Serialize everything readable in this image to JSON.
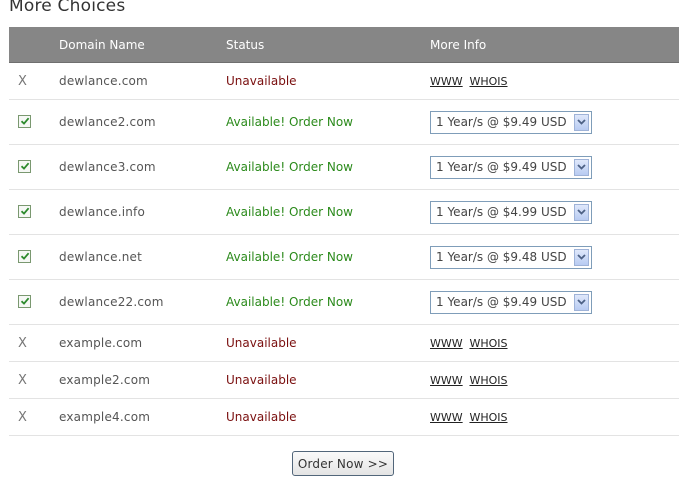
{
  "page_title": "More Choices",
  "table": {
    "headers": {
      "domain_name": "Domain Name",
      "status": "Status",
      "more_info": "More Info"
    },
    "rows": [
      {
        "domain": "dewlance.com",
        "available": false,
        "marker": "X",
        "status": "Unavailable",
        "www": "WWW",
        "whois": "WHOIS"
      },
      {
        "domain": "dewlance2.com",
        "available": true,
        "checked": true,
        "status": "Available! Order Now",
        "option": "1 Year/s @ $9.49 USD"
      },
      {
        "domain": "dewlance3.com",
        "available": true,
        "checked": true,
        "status": "Available! Order Now",
        "option": "1 Year/s @ $9.49 USD"
      },
      {
        "domain": "dewlance.info",
        "available": true,
        "checked": true,
        "status": "Available! Order Now",
        "option": "1 Year/s @ $4.99 USD"
      },
      {
        "domain": "dewlance.net",
        "available": true,
        "checked": true,
        "status": "Available! Order Now",
        "option": "1 Year/s @ $9.48 USD"
      },
      {
        "domain": "dewlance22.com",
        "available": true,
        "checked": true,
        "status": "Available! Order Now",
        "option": "1 Year/s @ $9.49 USD"
      },
      {
        "domain": "example.com",
        "available": false,
        "marker": "X",
        "status": "Unavailable",
        "www": "WWW",
        "whois": "WHOIS"
      },
      {
        "domain": "example2.com",
        "available": false,
        "marker": "X",
        "status": "Unavailable",
        "www": "WWW",
        "whois": "WHOIS"
      },
      {
        "domain": "example4.com",
        "available": false,
        "marker": "X",
        "status": "Unavailable",
        "www": "WWW",
        "whois": "WHOIS"
      }
    ]
  },
  "order_button": "Order Now >>",
  "colors": {
    "header_bg": "#868686",
    "unavailable": "#7a0f0f",
    "available": "#2b8a1b",
    "check": "#2d8a2d"
  },
  "icons": {
    "check": "checkmark-icon",
    "dropdown": "chevron-down-icon"
  }
}
